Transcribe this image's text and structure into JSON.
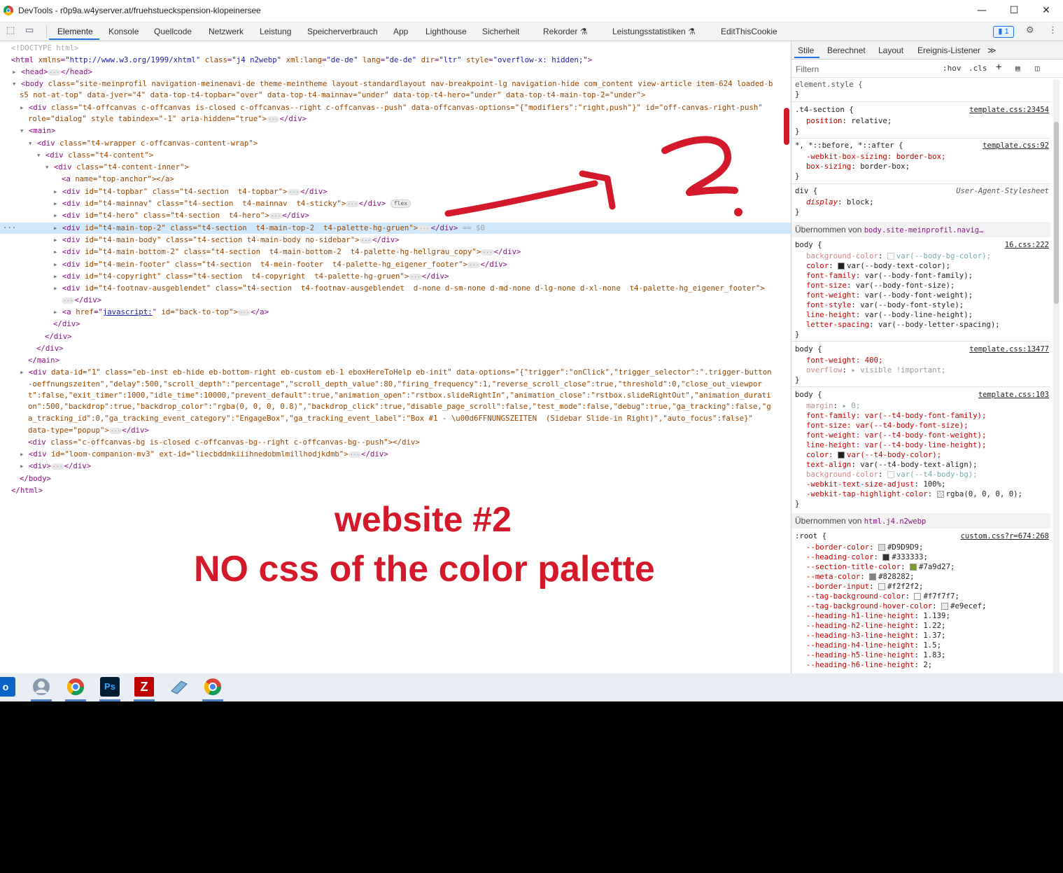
{
  "window": {
    "title": "DevTools - r0p9a.w4yserver.at/fruehstueckspension-klopeinersee",
    "min": "—",
    "max": "☐",
    "close": "✕"
  },
  "tabs": {
    "elements": "Elemente",
    "console": "Konsole",
    "sources": "Quellcode",
    "network": "Netzwerk",
    "performance": "Leistung",
    "memory": "Speicherverbrauch",
    "application": "App",
    "lighthouse": "Lighthouse",
    "security": "Sicherheit",
    "recorder": "Rekorder ⚗",
    "perfinsights": "Leistungsstatistiken ⚗",
    "editthiscookie": "EditThisCookie",
    "issues_count": "1"
  },
  "dom": {
    "doctype": "<!DOCTYPE html>",
    "html_open": [
      "<html",
      " xmlns",
      "=\"http://www.w3.org/1999/xhtml\"",
      " class",
      "=\"j4 n2webp\"",
      " xml:lang",
      "=\"de-de\"",
      " lang",
      "=\"de-de\"",
      " dir",
      "=\"ltr\"",
      " style",
      "=\"overflow-x: hidden;\"",
      ">"
    ],
    "head": "<head>",
    "head_close": "</head>",
    "body1": "class=\"site-meinprofil navigation-meinenavi-de theme-meintheme layout-standardlayout nav-breakpoint-lg navigation-hide com_content view-article item-624 loaded-b",
    "body2": "s5 not-at-top\" data-jver=\"4\" data-top-t4-topbar=\"over\" data-top-t4-mainnav=\"under\" data-top-t4-hero=\"under\" data-top-t4-main-top-2=\"under\">",
    "offcanvas1": "class=\"t4-offcanvas c-offcanvas is-closed c-offcanvas--right c-offcanvas--push\" data-offcanvas-options=\"{\"modifiers\":\"right,push\"}\" id=\"off-canvas-right-push\"",
    "offcanvas2": "role=\"dialog\" style tabindex=\"-1\" aria-hidden=\"true\">",
    "main": "<main>",
    "wrapper": "class=\"t4-wrapper c-offcanvas-content-wrap\">",
    "content": "class=\"t4-content\">",
    "content_inner": "class=\"t4-content-inner\">",
    "anchor": "name=\"top-anchor\"></a>",
    "topbar": "id=\"t4-topbar\" class=\"t4-section  t4-topbar\">",
    "mainnav": "id=\"t4-mainnav\" class=\"t4-section  t4-mainnav  t4-sticky\">",
    "flex": "flex",
    "hero": "id=\"t4-hero\" class=\"t4-section  t4-hero\">",
    "maintop2": "id=\"t4-main-top-2\" class=\"t4-section  t4-main-top-2  t4-palette-hg-gruen\">",
    "eq0": "== $0",
    "mainbody": "id=\"t4-main-body\" class=\"t4-section t4-main-body no-sidebar\">",
    "mainbottom2": "id=\"t4-main-bottom-2\" class=\"t4-section  t4-main-bottom-2  t4-palette-hg-hellgrau_copy\">",
    "footer": "id=\"t4-mein-footer\" class=\"t4-section  t4-mein-footer  t4-palette-hg_eigener_footer\">",
    "copyright": "id=\"t4-copyright\" class=\"t4-section  t4-copyright  t4-palette-hg-gruen\">",
    "footnav": "id=\"t4-footnav-ausgeblendet\" class=\"t4-section  t4-footnav-ausgeblendet  d-none d-sm-none d-md-none d-lg-none d-xl-none  t4-palette-hg_eigener_footer\">",
    "div_close": "</div>",
    "backtotop_href": "javascript:",
    "backtotop_rest": "id=\"back-to-top\">",
    "main_close": "</main>",
    "ebox1": "data-id=\"1\" class=\"eb-inst eb-hide eb-bottom-right eb-custom eb-1 eboxHereToHelp eb-init\" data-options=\"{\"trigger\":\"onClick\",\"trigger_selector\":\".trigger-button",
    "ebox2": "-oeffnungszeiten\",\"delay\":500,\"scroll_depth\":\"percentage\",\"scroll_depth_value\":80,\"firing_frequency\":1,\"reverse_scroll_close\":true,\"threshold\":0,\"close_out_viewpor",
    "ebox3": "t\":false,\"exit_timer\":1000,\"idle_time\":10000,\"prevent_default\":true,\"animation_open\":\"rstbox.slideRightIn\",\"animation_close\":\"rstbox.slideRightOut\",\"animation_durati",
    "ebox4": "on\":500,\"backdrop\":true,\"backdrop_color\":\"rgba(0, 0, 0, 0.8)\",\"backdrop_click\":true,\"disable_page_scroll\":false,\"test_mode\":false,\"debug\":true,\"ga_tracking\":false,\"g",
    "ebox5": "a_tracking_id\":0,\"ga_tracking_event_category\":\"EngageBox\",\"ga_tracking_event_label\":\"Box #1 - \\u00d6FFNUNGSZEITEN  (Sidebar Slide-in Right)\",\"auto_focus\":false}\"",
    "ebox6": "data-type=\"popup\">",
    "offbg": "class=\"c-offcanvas-bg is-closed c-offcanvas-bg--right c-offcanvas-bg--push\"></div>",
    "loom": "id=\"loom-companion-mv3\" ext-id=\"liecbddmkiiihnedobmlmillhodjkdmb\">",
    "div_empty": "<div>",
    "body_close": "</body>",
    "html_close": "</html>",
    "dots": "···"
  },
  "styles": {
    "tabs": [
      "Stile",
      "Berechnet",
      "Layout",
      "Ereignis-Listener",
      "≫"
    ],
    "filter_placeholder": "Filtern",
    "hov": ":hov",
    "cls": ".cls",
    "rules": {
      "element_style": "element.style {",
      "t4section_sel": ".t4-section {",
      "t4section_src": "template.css:23454",
      "t4section_prop": "position",
      "t4section_val": "relative;",
      "star_sel": "*, *::before, *::after {",
      "star_src": "template.css:92",
      "star_p1": "-webkit-box-sizing: border-box;",
      "star_p2": "box-sizing",
      "star_v2": "border-box;",
      "div_sel": "div {",
      "div_src": "User-Agent-Stylesheet",
      "div_p": "display",
      "div_v": "block;",
      "inh1_label": "Übernommen von ",
      "inh1_ref": "body.site-meinprofil.navig…",
      "body1_src": "16.css:222",
      "body1_props": [
        [
          "background-color",
          "var(--body-bg-color);"
        ],
        [
          "color",
          "var(--body-text-color);"
        ],
        [
          "font-family",
          "var(--body-font-family);"
        ],
        [
          "font-size",
          "var(--body-font-size);"
        ],
        [
          "font-weight",
          "var(--body-font-weight);"
        ],
        [
          "font-style",
          "var(--body-font-style);"
        ],
        [
          "line-height",
          "var(--body-line-height);"
        ],
        [
          "letter-spacing",
          "var(--body-letter-spacing);"
        ]
      ],
      "body2_src": "template.css:13477",
      "body2_p1": "font-weight: 400;",
      "body2_p2": "overflow",
      "body2_v2": "▸ visible !important;",
      "body3_src": "template.css:103",
      "body3_props": [
        [
          "margin",
          "▸ 0;"
        ],
        [
          "font-family: var(--t4-body-font-family);",
          ""
        ],
        [
          "font-size: var(--t4-body-font-size);",
          ""
        ],
        [
          "font-weight: var(--t4-body-font-weight);",
          ""
        ],
        [
          "line-height: var(--t4-body-line-height);",
          ""
        ],
        [
          "color:",
          "var(--t4-body-color);"
        ],
        [
          "text-align",
          "var(--t4-body-text-align);"
        ],
        [
          "background-color",
          "var(--t4-body-bg);"
        ],
        [
          "-webkit-text-size-adjust",
          "100%;"
        ],
        [
          "-webkit-tap-highlight-color",
          "rgba(0, 0, 0, 0);"
        ]
      ],
      "inh2_label": "Übernommen von ",
      "inh2_ref": "html.j4.n2webp",
      "root_sel": ":root {",
      "root_src": "custom.css?r=674:268",
      "root_props": [
        [
          "--border-color",
          "#D9D9D9;",
          "#D9D9D9"
        ],
        [
          "--heading-color",
          "#333333;",
          "#333333"
        ],
        [
          "--section-title-color",
          "#7a9d27;",
          "#7a9d27"
        ],
        [
          "--meta-color",
          "#828282;",
          "#828282"
        ],
        [
          "--border-input",
          "#f2f2f2;",
          "#f2f2f2"
        ],
        [
          "--tag-background-color",
          "#f7f7f7;",
          "#f7f7f7"
        ],
        [
          "--tag-background-hover-color",
          "#e9ecef;",
          "#e9ecef"
        ],
        [
          "--heading-h1-line-height",
          "1.139;",
          ""
        ],
        [
          "--heading-h2-line-height",
          "1.22;",
          ""
        ],
        [
          "--heading-h3-line-height",
          "1.37;",
          ""
        ],
        [
          "--heading-h4-line-height",
          "1.5;",
          ""
        ],
        [
          "--heading-h5-line-height",
          "1.83;",
          ""
        ],
        [
          "--heading-h6-line-height",
          "2;",
          ""
        ]
      ]
    }
  },
  "annotation": {
    "two": "2.",
    "line1": "website #2",
    "line2": "NO css of the color palette",
    "color": "#d41a2a"
  },
  "taskbar": [
    "outlook-icon",
    "user-icon",
    "chrome-icon",
    "photoshop-icon",
    "filezilla-icon",
    "notepad-icon",
    "chrome-icon"
  ]
}
